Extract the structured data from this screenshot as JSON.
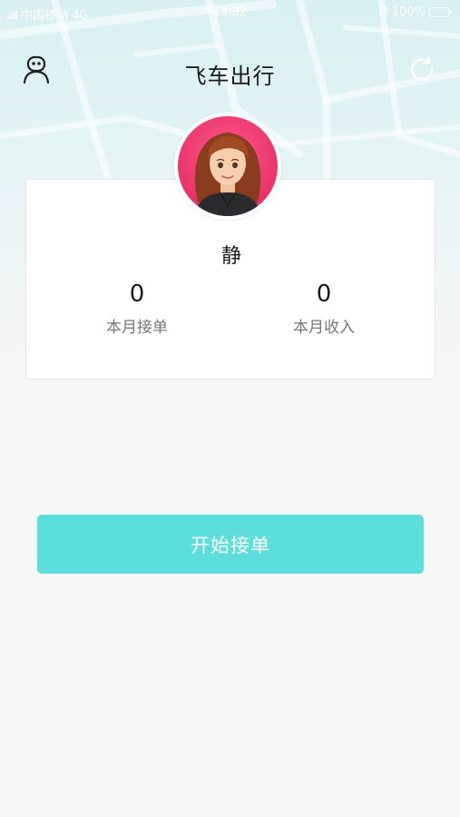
{
  "status_bar": {
    "carrier": "中国移动 4G",
    "time": "13:32",
    "battery": "100%"
  },
  "nav": {
    "title": "飞车出行",
    "left_icon": "profile-icon",
    "right_icon": "refresh-icon"
  },
  "profile": {
    "avatar": "avatar-image",
    "name": "静"
  },
  "stats": [
    {
      "value": "0",
      "label": "本月接单"
    },
    {
      "value": "0",
      "label": "本月收入"
    }
  ],
  "actions": {
    "start_label": "开始接单"
  },
  "colors": {
    "accent": "#5cdedc",
    "avatar_bg": "#e8336a",
    "page_bg": "#f6f7f7"
  }
}
